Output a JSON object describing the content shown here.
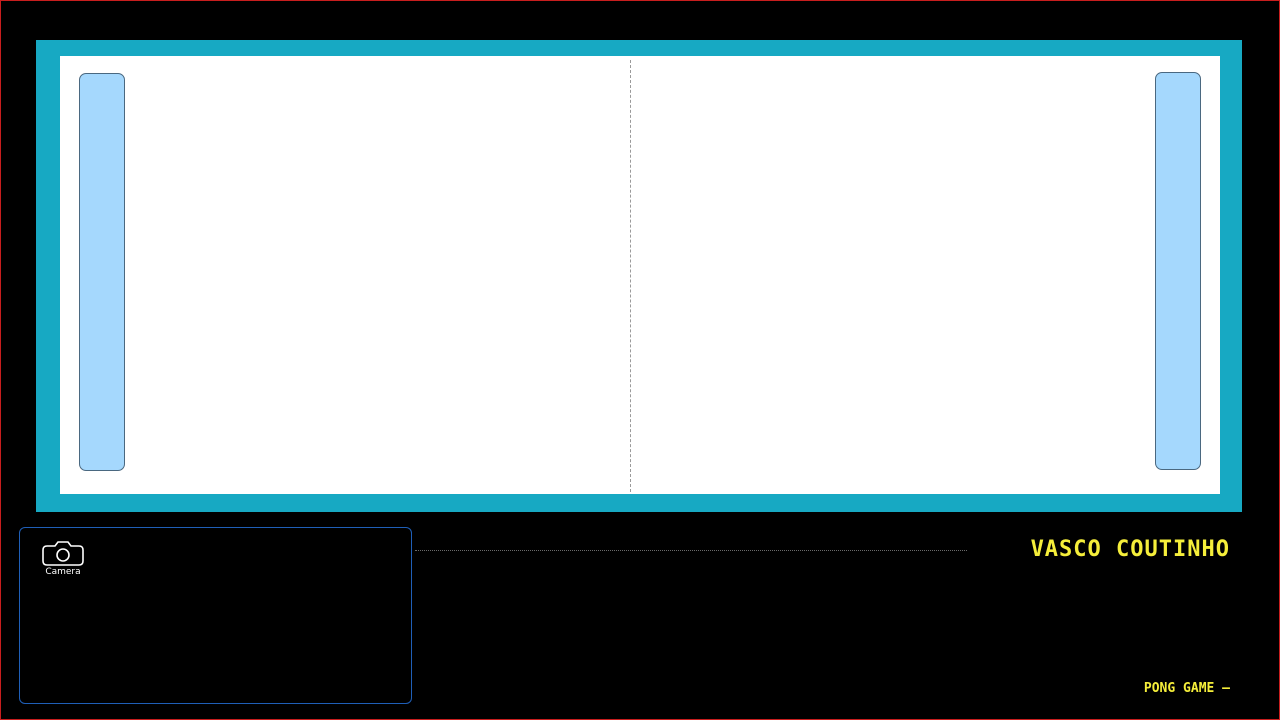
{
  "colors": {
    "background": "#000000",
    "frame_border": "#c81e1e",
    "arena_border": "#17a9c3",
    "court": "#ffffff",
    "paddle_fill": "#a5d8fd",
    "paddle_stroke": "#4a6880",
    "camera_panel_border": "#1f5fb8",
    "accent_text": "#f5ee3a"
  },
  "arena": {
    "left_paddle_icon": "paddle",
    "right_paddle_icon": "paddle",
    "center_line": "dashed"
  },
  "camera": {
    "icon": "camera-icon",
    "label": "Camera"
  },
  "player": {
    "name": "VASCO COUTINHO"
  },
  "footer": {
    "game_title": "PONG GAME –"
  }
}
